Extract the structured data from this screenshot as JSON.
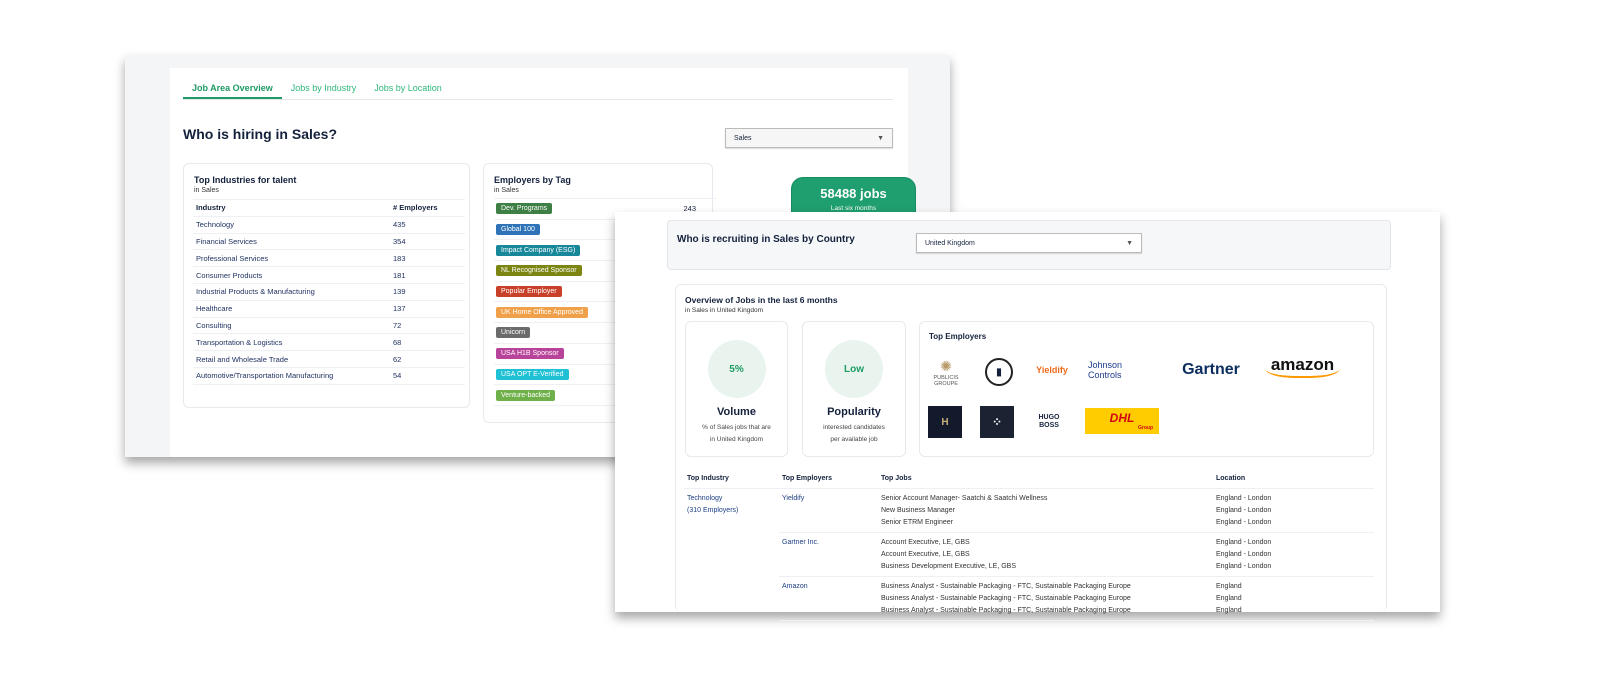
{
  "overview": {
    "tabs": [
      "Job Area Overview",
      "Jobs by Industry",
      "Jobs by Location"
    ],
    "active_tab": 0,
    "title": "Who is hiring in Sales?",
    "job_area_select": "Sales",
    "industries": {
      "title": "Top Industries for talent",
      "subtitle": "in Sales",
      "headers": [
        "Industry",
        "# Employers"
      ],
      "rows": [
        [
          "Technology",
          "435"
        ],
        [
          "Financial Services",
          "354"
        ],
        [
          "Professional Services",
          "183"
        ],
        [
          "Consumer Products",
          "181"
        ],
        [
          "Industrial Products & Manufacturing",
          "139"
        ],
        [
          "Healthcare",
          "137"
        ],
        [
          "Consulting",
          "72"
        ],
        [
          "Transportation & Logistics",
          "68"
        ],
        [
          "Retail and Wholesale Trade",
          "62"
        ],
        [
          "Automotive/Transportation Manufacturing",
          "54"
        ]
      ]
    },
    "tags": {
      "title": "Employers by Tag",
      "subtitle": "in Sales",
      "rows": [
        {
          "label": "Dev. Programs",
          "count": "243",
          "color": "#3d7f45"
        },
        {
          "label": "Global 100",
          "color": "#2e73b8"
        },
        {
          "label": "Impact Company (ESG)",
          "color": "#17879a"
        },
        {
          "label": "NL Recognised Sponsor",
          "color": "#7c8512"
        },
        {
          "label": "Popular Employer",
          "color": "#c9402a"
        },
        {
          "label": "UK Home Office Approved",
          "color": "#f0a048"
        },
        {
          "label": "Unicorn",
          "color": "#6b6b6b"
        },
        {
          "label": "USA H1B Sponsor",
          "color": "#b8439a"
        },
        {
          "label": "USA OPT E-Verified",
          "color": "#1ec0d4"
        },
        {
          "label": "Venture-backed",
          "color": "#6fb04a"
        }
      ]
    },
    "jobs_count": "58488 jobs",
    "jobs_period": "Last six months"
  },
  "country": {
    "title": "Who is recruiting in Sales by Country",
    "country_select": "United Kingdom",
    "overview_title": "Overview of Jobs in the last 6 months",
    "overview_subtitle": "in Sales in United Kingdom",
    "volume": {
      "value": "5%",
      "label": "Volume",
      "desc1": "% of Sales jobs that are",
      "desc2": "in United Kingdom"
    },
    "popularity": {
      "value": "Low",
      "label": "Popularity",
      "desc1": "interested candidates",
      "desc2": "per available job"
    },
    "top_employers_title": "Top Employers",
    "logos": {
      "publicis": "PUBLICIS GROUPE",
      "yieldify": "Yieldify",
      "jc1": "Johnson",
      "jc2": "Controls",
      "gartner": "Gartner",
      "amazon": "amazon",
      "hugo": "HUGO BOSS",
      "dhl": "DHL",
      "dhl_group": "Group"
    },
    "table": {
      "headers": [
        "Top Industry",
        "Top Employers",
        "Top Jobs",
        "Location"
      ],
      "industry": "Technology",
      "industry_count": "(310 Employers)",
      "groups": [
        {
          "employer": "Yieldify",
          "jobs": [
            [
              "Senior Account Manager- Saatchi & Saatchi Wellness",
              "England - London"
            ],
            [
              "New Business Manager",
              "England - London"
            ],
            [
              "Senior ETRM Engineer",
              "England - London"
            ]
          ]
        },
        {
          "employer": "Gartner Inc.",
          "jobs": [
            [
              "Account Executive, LE, GBS",
              "England - London"
            ],
            [
              "Account Executive, LE, GBS",
              "England - London"
            ],
            [
              "Business Development Executive, LE, GBS",
              "England - London"
            ]
          ]
        },
        {
          "employer": "Amazon",
          "jobs": [
            [
              "Business Analyst - Sustainable Packaging - FTC, Sustainable Packaging Europe",
              "England"
            ],
            [
              "Business Analyst - Sustainable Packaging - FTC, Sustainable Packaging Europe",
              "England"
            ],
            [
              "Business Analyst - Sustainable Packaging - FTC, Sustainable Packaging Europe",
              "England"
            ]
          ]
        }
      ]
    }
  }
}
